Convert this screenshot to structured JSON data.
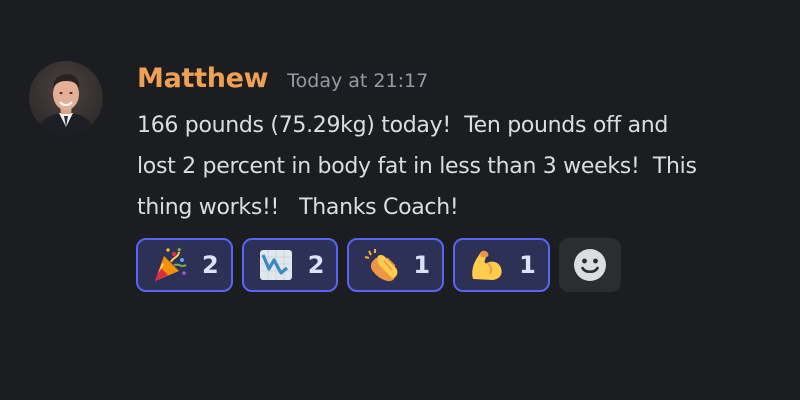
{
  "message": {
    "author": {
      "username": "Matthew",
      "username_color": "#f0a052",
      "avatar": "user-avatar-photo"
    },
    "timestamp": "Today at 21:17",
    "content": "166 pounds (75.29kg) today!  Ten pounds off and\nlost 2 percent in body fat in less than 3 weeks!  This\nthing works!!   Thanks Coach!",
    "reactions": [
      {
        "emoji": "party-popper-icon",
        "count": "2"
      },
      {
        "emoji": "chart-decreasing-icon",
        "count": "2"
      },
      {
        "emoji": "clapping-hands-icon",
        "count": "1"
      },
      {
        "emoji": "flexed-biceps-icon",
        "count": "1"
      }
    ],
    "add_reaction_icon": "smiley-add-reaction-icon"
  },
  "colors": {
    "background": "#1c1d21",
    "reaction_bg": "#2e3156",
    "reaction_border": "#5865f2",
    "text": "#dbdee1",
    "muted": "#949ba4"
  }
}
